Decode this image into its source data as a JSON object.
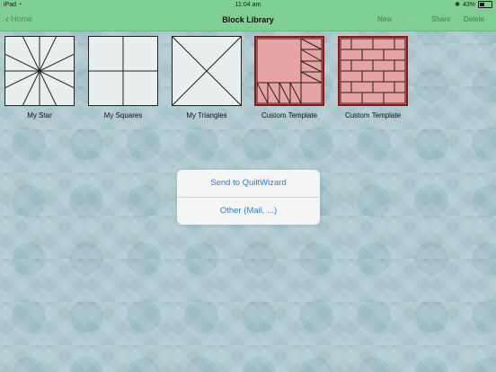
{
  "statusbar": {
    "device": "iPad",
    "time": "11:04 am",
    "battery": "43%"
  },
  "nav": {
    "back_label": "Home",
    "title": "Block Library",
    "buttons": {
      "new": "New",
      "edit": "Edit",
      "share": "Share",
      "delete": "Delete"
    }
  },
  "blocks": [
    {
      "label": "My Star"
    },
    {
      "label": "My Squares"
    },
    {
      "label": "My Triangles"
    },
    {
      "label": "Custom Template"
    },
    {
      "label": "Custom Template"
    }
  ],
  "dialog": {
    "options": [
      "Send to QuiltWizard",
      "Other (Mail, ...)"
    ]
  },
  "colors": {
    "navbar": "#7fce94",
    "accent": "#2a7ae2",
    "template_fill": "#e8a3a3",
    "template_border": "#9b0f0f"
  }
}
